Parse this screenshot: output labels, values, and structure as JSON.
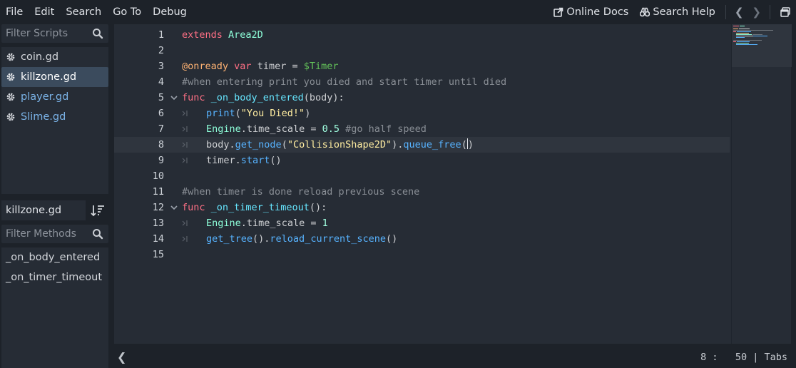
{
  "menu": [
    "File",
    "Edit",
    "Search",
    "Go To",
    "Debug"
  ],
  "help": {
    "online_docs": "Online Docs",
    "search_help": "Search Help"
  },
  "scripts": {
    "filter_placeholder": "Filter Scripts",
    "items": [
      {
        "name": "coin.gd",
        "selected": false,
        "color": "#d3d6db"
      },
      {
        "name": "killzone.gd",
        "selected": true,
        "color": "#ffffff"
      },
      {
        "name": "player.gd",
        "selected": false,
        "color": "#7ab2e6"
      },
      {
        "name": "Slime.gd",
        "selected": false,
        "color": "#7ab2e6"
      }
    ],
    "current": "killzone.gd"
  },
  "methods": {
    "filter_placeholder": "Filter Methods",
    "items": [
      "_on_body_entered",
      "_on_timer_timeout"
    ]
  },
  "editor": {
    "line_numbers": [
      "1",
      "2",
      "3",
      "4",
      "5",
      "6",
      "7",
      "8",
      "9",
      "10",
      "11",
      "12",
      "13",
      "14",
      "15"
    ],
    "current_line": 8,
    "lines": [
      "extends Area2D",
      "",
      "@onready var timer = $Timer",
      "#when entering print you died and start timer until died",
      "func _on_body_entered(body):",
      "print(\"You Died!\")",
      "Engine.time_scale = 0.5 #go half speed",
      "body.get_node(\"CollisionShape2D\").queue_free()",
      "timer.start()",
      "",
      "#when timer is done reload previous scene",
      "func _on_timer_timeout():",
      "Engine.time_scale = 1",
      "get_tree().reload_current_scene()",
      ""
    ]
  },
  "status": {
    "text": "8 :   50 | Tabs"
  },
  "colors": {
    "background": "#1d2229",
    "panel": "#262c35",
    "keyword": "#ff7085",
    "type": "#8effda",
    "annotation": "#ffb373",
    "function": "#57b3ff",
    "string": "#ffeda1",
    "number": "#a1ffe0",
    "comment": "#8a8f96",
    "node_path": "#63c259"
  }
}
